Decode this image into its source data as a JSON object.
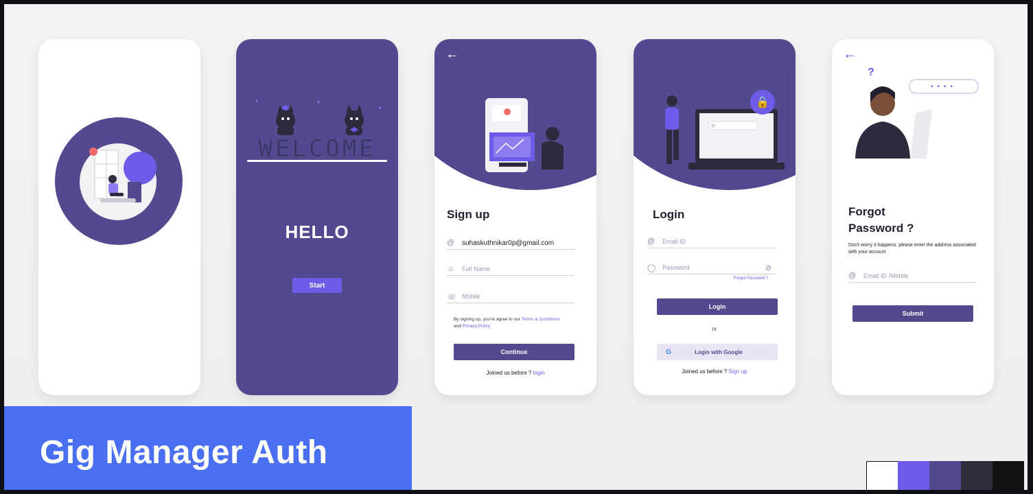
{
  "banner": {
    "title": "Gig Manager Auth"
  },
  "screens": {
    "splash": {},
    "welcome": {
      "illustration_text": "WELCOME",
      "hello": "HELLO",
      "start_label": "Start"
    },
    "signup": {
      "back_icon": "arrow-left-icon",
      "title": "Sign up",
      "email_value": "suhaskuthnikar0p@gmail.com",
      "fullname_placeholder": "Full Name",
      "mobile_placeholder": "Mobile",
      "terms_prefix": "By signing up, you're agree to our",
      "terms_link": "Terms & Conditions",
      "terms_and": "and",
      "privacy_link": "Privacy Policy",
      "continue_label": "Continue",
      "joined_text": "Joined us before ?",
      "login_link": "login"
    },
    "login": {
      "title": "Login",
      "email_placeholder": "Email ID",
      "password_placeholder": "Password",
      "forgot_link": "Forgot Password ?",
      "login_label": "Login",
      "or_text": "or",
      "google_label": "Login with Google",
      "joined_text": "Joined us before ?",
      "signup_link": "Sign up"
    },
    "forgot": {
      "back_icon": "arrow-left-icon",
      "title_line1": "Forgot",
      "title_line2": "Password ?",
      "subtext": "Don't worry it happens. please enter the address associated with your account",
      "email_placeholder": "Email ID /Mobile",
      "submit_label": "Submit"
    }
  },
  "colors": {
    "primary": "#52498e",
    "accent": "#6c5ce7",
    "banner": "#4a6ff0",
    "palette": [
      "#ffffff",
      "#6c5ce7",
      "#52498e",
      "#2f2d3a",
      "#111111"
    ]
  }
}
